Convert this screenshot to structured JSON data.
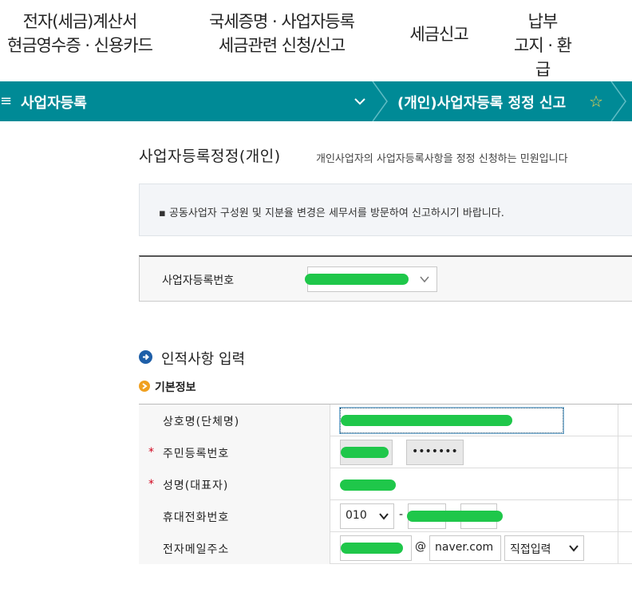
{
  "top_menu": {
    "item1_line1": "전자(세금)계산서",
    "item1_line2": "현금영수증 · 신용카드",
    "item2_line1": "국세증명 · 사업자등록",
    "item2_line2": "세금관련 신청/신고",
    "item3": "세금신고",
    "item4_line1": "납부",
    "item4_line2": "고지 · 환급"
  },
  "breadcrumb": {
    "menu_icon": "≡",
    "section": "사업자등록",
    "current": "(개인)사업자등록 정정 신고",
    "star_icon": "☆"
  },
  "page": {
    "title": "사업자등록정정(개인)",
    "description": "개인사업자의 사업자등록사항을 정정 신청하는 민원입니다"
  },
  "notice": {
    "text": "▪ 공동사업자 구성원 및 지분율 변경은 세무서를 방문하여 신고하시기 바랍니다."
  },
  "registration": {
    "label": "사업자등록번호"
  },
  "section": {
    "title": "인적사항 입력",
    "subtitle": "기본정보"
  },
  "form": {
    "company_label": "상호명(단체명)",
    "resident_label": "주민등록번호",
    "resident_masked": "•••••••",
    "name_label": "성명(대표자)",
    "phone_label": "휴대전화번호",
    "phone_prefix": "010",
    "phone_dash": "-",
    "email_label": "전자메일주소",
    "email_at": "@",
    "email_domain": "naver.com",
    "email_domain_select": "직접입력",
    "required_mark": "*"
  },
  "colors": {
    "accent_bar": "#008a96",
    "star": "#f4d24a",
    "required": "#d0021b",
    "redaction": "#1fc74a"
  }
}
